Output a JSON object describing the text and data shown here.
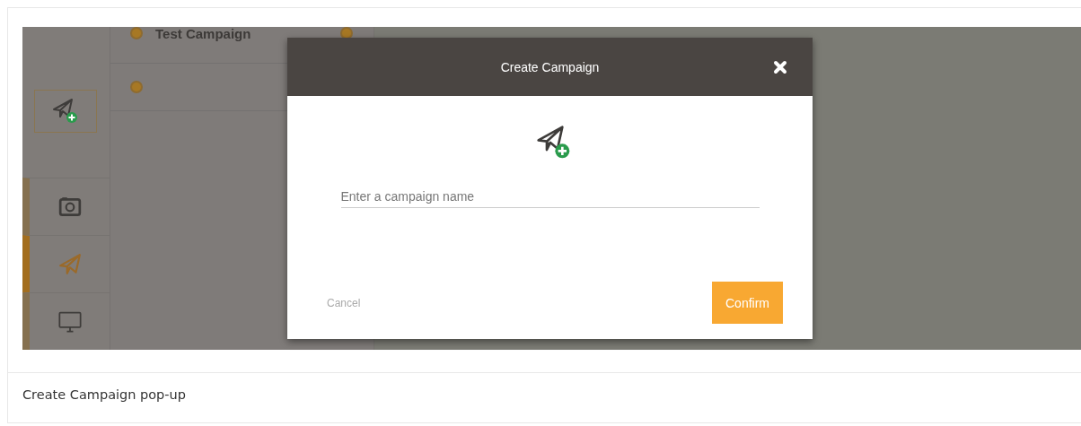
{
  "sidebar": {
    "items": [
      {
        "kind": "camera",
        "selected": false
      },
      {
        "kind": "plane",
        "selected": true
      },
      {
        "kind": "monitor",
        "selected": false
      }
    ]
  },
  "campaigns": [
    {
      "kind": "named",
      "name": "Test Campaign"
    },
    {
      "kind": "blank"
    }
  ],
  "dialog": {
    "title": "Create Campaign",
    "field": {
      "placeholder": "Enter a campaign name"
    },
    "buttons": [
      {
        "kind": "text",
        "label": "Cancel"
      },
      {
        "kind": "primary",
        "label": "Confirm"
      }
    ]
  },
  "caption": "Create Campaign pop-up"
}
